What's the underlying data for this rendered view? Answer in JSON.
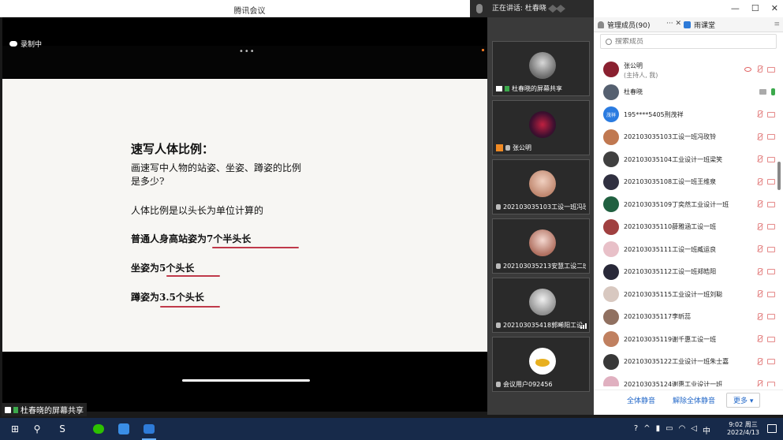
{
  "window": {
    "title": "腾讯会议",
    "speaking": "正在讲话: 杜春晓"
  },
  "recording": {
    "label": "录制中"
  },
  "share_label": "杜春晓的屏幕共享",
  "slide": {
    "heading": "速写人体比例：",
    "lines": [
      "画速写中人物的站姿、坐姿、蹲姿的比例",
      "是多少?",
      "人体比例是以头长为单位计算的",
      "普通人身高站姿为7个半头长",
      "坐姿为5个头长",
      "蹲姿为3.5个头长"
    ]
  },
  "video_tiles": [
    {
      "name": "杜春晓的屏幕共享",
      "type": "screen"
    },
    {
      "name": "张公明",
      "type": "host"
    },
    {
      "name": "202103035103工设一班冯玫铃",
      "type": "member"
    },
    {
      "name": "202103035213安慧工设二班",
      "type": "member"
    },
    {
      "name": "202103035418郭晞阳工设...",
      "type": "member"
    },
    {
      "name": "会议用户092456",
      "type": "member"
    }
  ],
  "panel": {
    "tab_members": "管理成员(90)",
    "tab_controls": "··· ✕",
    "tab_rainclass": "雨课堂",
    "search_placeholder": "搜索成员",
    "members": [
      {
        "name": "张公明",
        "sub": "(主持人, 我)",
        "color": "#8a2030"
      },
      {
        "name": "杜春晓",
        "sub": "",
        "color": "#556070"
      },
      {
        "name": "195****5405刑茂祥",
        "sub": "",
        "color": "#2a7be0",
        "badge": "茂祥"
      },
      {
        "name": "202103035103工设一班冯玫铃",
        "sub": "",
        "color": "#c07850"
      },
      {
        "name": "202103035104工业设计一班梁笑",
        "sub": "",
        "color": "#404040"
      },
      {
        "name": "202103035108工设一班王维泉",
        "sub": "",
        "color": "#303040"
      },
      {
        "name": "202103035109丁奕然工业设计一班",
        "sub": "",
        "color": "#206040"
      },
      {
        "name": "202103035110薛雅涵工设一班",
        "sub": "",
        "color": "#a04040"
      },
      {
        "name": "202103035111工设一班臧运良",
        "sub": "",
        "color": "#e8c0c8"
      },
      {
        "name": "202103035112工设一班郑皓阳",
        "sub": "",
        "color": "#282838"
      },
      {
        "name": "202103035115工业设计一班刘聪",
        "sub": "",
        "color": "#d8c8c0"
      },
      {
        "name": "202103035117李昕蕊",
        "sub": "",
        "color": "#907060"
      },
      {
        "name": "202103035119谢千惠工设一班",
        "sub": "",
        "color": "#c08060"
      },
      {
        "name": "202103035122工业设计一班朱士嘉",
        "sub": "",
        "color": "#383838"
      },
      {
        "name": "202103035124谢惠工业设计一班",
        "sub": "",
        "color": "#e0b0c0"
      }
    ],
    "footer": {
      "mute_all": "全体静音",
      "unmute_all": "解除全体静音",
      "more": "更多 ▾"
    }
  },
  "window_controls": {
    "min": "—",
    "max": "☐",
    "close": "✕"
  },
  "taskbar": {
    "time": "9:02 周三",
    "date": "2022/4/13",
    "ime": "中"
  }
}
